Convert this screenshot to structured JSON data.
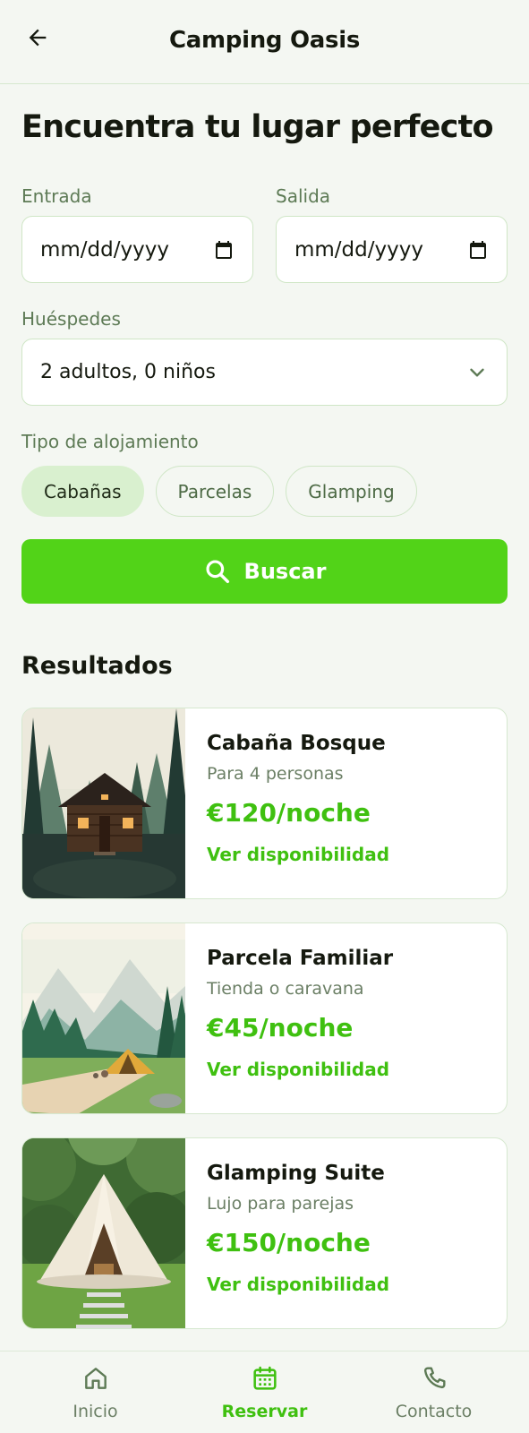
{
  "header": {
    "title": "Camping Oasis",
    "back_icon": "arrow-left-icon"
  },
  "page": {
    "heading": "Encuentra tu lugar perfecto"
  },
  "form": {
    "checkin_label": "Entrada",
    "checkin_value": "mm/dd/yyyy",
    "checkout_label": "Salida",
    "checkout_value": "mm/dd/yyyy",
    "guests_label": "Huéspedes",
    "guests_value": "2 adultos, 0 niños",
    "type_label": "Tipo de alojamiento",
    "types": [
      {
        "label": "Cabañas",
        "selected": true
      },
      {
        "label": "Parcelas",
        "selected": false
      },
      {
        "label": "Glamping",
        "selected": false
      }
    ],
    "search_label": "Buscar"
  },
  "results": {
    "title": "Resultados",
    "items": [
      {
        "name": "Cabaña Bosque",
        "desc": "Para 4 personas",
        "price": "€120/noche",
        "link": "Ver disponibilidad"
      },
      {
        "name": "Parcela Familiar",
        "desc": "Tienda o caravana",
        "price": "€45/noche",
        "link": "Ver disponibilidad"
      },
      {
        "name": "Glamping Suite",
        "desc": "Lujo para parejas",
        "price": "€150/noche",
        "link": "Ver disponibilidad"
      }
    ]
  },
  "nav": {
    "items": [
      {
        "label": "Inicio",
        "icon": "home-icon",
        "active": false
      },
      {
        "label": "Reservar",
        "icon": "calendar-icon",
        "active": true
      },
      {
        "label": "Contacto",
        "icon": "phone-icon",
        "active": false
      }
    ]
  },
  "colors": {
    "accent": "#52d318",
    "accent_text": "#3fc010",
    "background": "#f4f7f2",
    "border": "#cfe6c6"
  }
}
